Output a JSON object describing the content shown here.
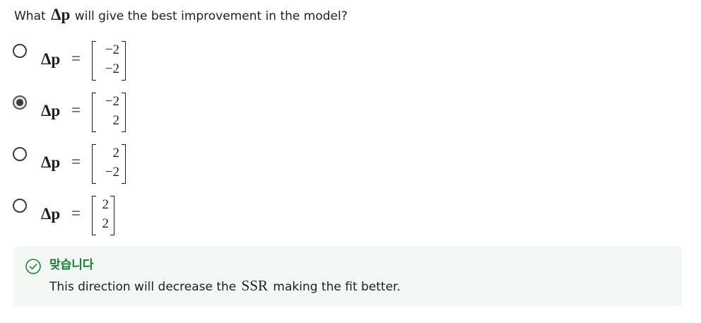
{
  "question": {
    "prefix": "What ",
    "symbol": "Δp",
    "suffix": " will give the best improvement in the model?"
  },
  "options": [
    {
      "lhs": "Δp",
      "eq": "=",
      "top": "−2",
      "bottom": "−2",
      "selected": false
    },
    {
      "lhs": "Δp",
      "eq": "=",
      "top": "−2",
      "bottom": "2",
      "selected": true
    },
    {
      "lhs": "Δp",
      "eq": "=",
      "top": "2",
      "bottom": "−2",
      "selected": false
    },
    {
      "lhs": "Δp",
      "eq": "=",
      "top": "2",
      "bottom": "2",
      "selected": false
    }
  ],
  "feedback": {
    "status": "맞습니다",
    "explanation_prefix": "This direction will decrease the ",
    "explanation_symbol": "SSR",
    "explanation_suffix": " making the fit better.",
    "accent_color": "#1e7d3a",
    "background_color": "#f3f8f4"
  }
}
